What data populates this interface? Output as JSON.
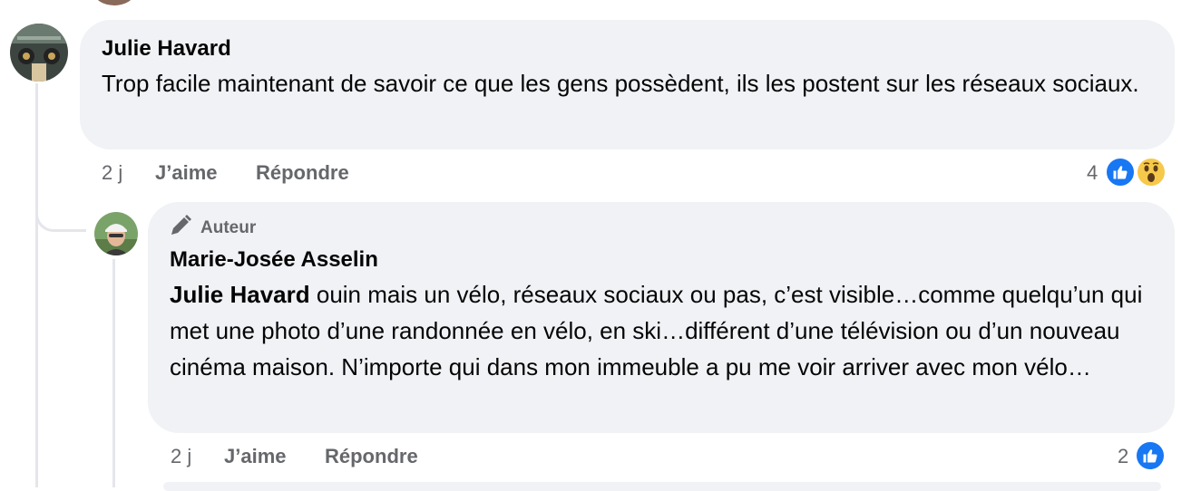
{
  "comment1": {
    "author": "Julie Havard",
    "text": "Trop facile maintenant de savoir ce que les gens possèdent, ils les postent sur les réseaux sociaux.",
    "time": "2 j",
    "like_label": "J’aime",
    "reply_label": "Répondre",
    "reaction_count": "4",
    "reactions": [
      "like-icon",
      "wow-icon"
    ]
  },
  "comment2": {
    "badge_label": "Auteur",
    "author": "Marie-Josée Asselin",
    "mention": "Julie Havard",
    "text": " ouin mais un vélo, réseaux sociaux ou pas, c’est visible…comme quelqu’un qui met une photo d’une randonnée en vélo, en ski…différent d’une télévision ou d’un nouveau cinéma maison. N’importe qui dans mon immeuble a pu me voir arriver avec mon vélo…",
    "time": "2 j",
    "like_label": "J’aime",
    "reply_label": "Répondre",
    "reaction_count": "2",
    "reactions": [
      "like-icon"
    ]
  },
  "colors": {
    "bubble": "#f0f2f5",
    "meta_text": "#65676b",
    "like_blue": "#1877f2",
    "wow_yellow": "#f7c94a"
  }
}
